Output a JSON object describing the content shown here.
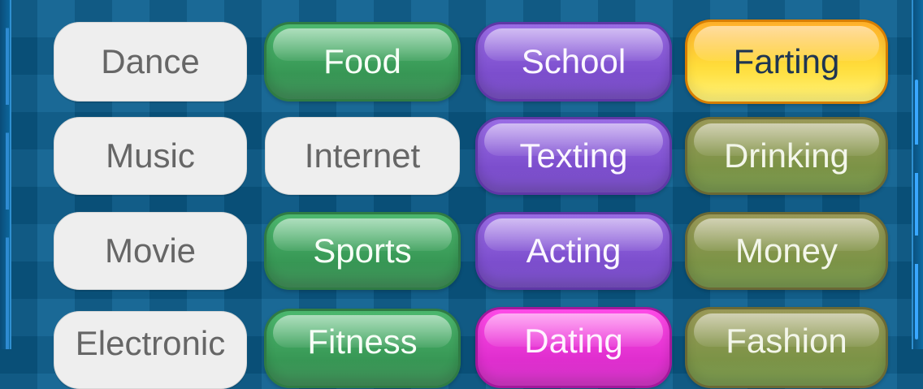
{
  "board": {
    "rows": [
      {
        "tiles": [
          {
            "label": "Dance",
            "style": "white"
          },
          {
            "label": "Food",
            "style": "green"
          },
          {
            "label": "School",
            "style": "purple"
          },
          {
            "label": "Farting",
            "style": "yellow"
          }
        ]
      },
      {
        "tiles": [
          {
            "label": "Music",
            "style": "white"
          },
          {
            "label": "Internet",
            "style": "white"
          },
          {
            "label": "Texting",
            "style": "purple"
          },
          {
            "label": "Drinking",
            "style": "olive"
          }
        ]
      },
      {
        "tiles": [
          {
            "label": "Movie",
            "style": "white"
          },
          {
            "label": "Sports",
            "style": "green"
          },
          {
            "label": "Acting",
            "style": "purple"
          },
          {
            "label": "Money",
            "style": "olive"
          }
        ]
      },
      {
        "tiles": [
          {
            "label": "Electronic",
            "style": "white"
          },
          {
            "label": "Fitness",
            "style": "green"
          },
          {
            "label": "Dating",
            "style": "magenta"
          },
          {
            "label": "Fashion",
            "style": "olive"
          }
        ]
      }
    ]
  },
  "colors": {
    "background": "#0b5f8f",
    "white_tile": "#eeeeee",
    "green_tile": "#3fa05f",
    "purple_tile": "#8558d2",
    "yellow_tile": "#ffd43a",
    "olive_tile": "#8a9550",
    "magenta_tile": "#ef36dc"
  }
}
